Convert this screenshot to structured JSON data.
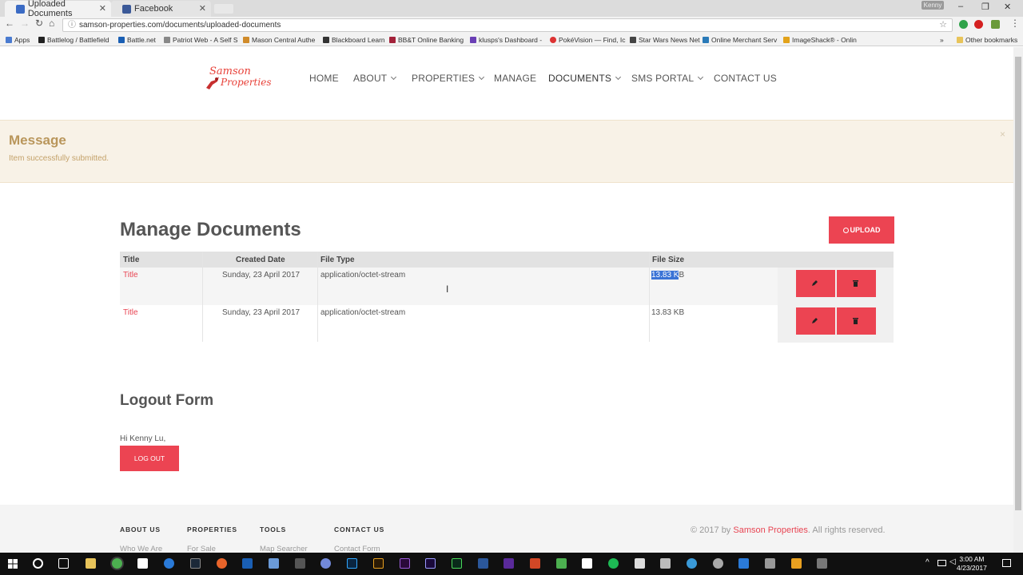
{
  "browser": {
    "tabs": [
      {
        "title": "Uploaded Documents",
        "active": true
      },
      {
        "title": "Facebook",
        "active": false
      }
    ],
    "profile": "Kenny",
    "window_controls": {
      "minimize": "–",
      "restore": "❐",
      "close": "✕"
    },
    "url": "samson-properties.com/documents/uploaded-documents",
    "bookmarks": [
      {
        "label": "Apps",
        "color": "#4a7bd0"
      },
      {
        "label": "Battlelog / Battlefield",
        "color": "#222"
      },
      {
        "label": "Battle.net",
        "color": "#1a5fb4"
      },
      {
        "label": "Patriot Web - A Self S",
        "color": "#888"
      },
      {
        "label": "Mason Central Authe",
        "color": "#d08b2a"
      },
      {
        "label": "Blackboard Learn",
        "color": "#333"
      },
      {
        "label": "BB&T Online Banking",
        "color": "#a3223a"
      },
      {
        "label": "klusps's Dashboard -",
        "color": "#6a3fb5"
      },
      {
        "label": "PokéVision — Find, Ic",
        "color": "#d33"
      },
      {
        "label": "Star Wars News Net",
        "color": "#444"
      },
      {
        "label": "Online Merchant Serv",
        "color": "#2a7ab8"
      },
      {
        "label": "ImageShack® - Onlin",
        "color": "#e2a21a"
      }
    ],
    "bookmarks_more": "»",
    "other_bookmarks": "Other bookmarks"
  },
  "site": {
    "logo_line1": "Samson",
    "logo_line2": "Properties",
    "nav": [
      {
        "label": "HOME",
        "dropdown": false
      },
      {
        "label": "ABOUT",
        "dropdown": true
      },
      {
        "label": "PROPERTIES",
        "dropdown": true
      },
      {
        "label": "MANAGE",
        "dropdown": false
      },
      {
        "label": "DOCUMENTS",
        "dropdown": true
      },
      {
        "label": "SMS PORTAL",
        "dropdown": true
      },
      {
        "label": "CONTACT US",
        "dropdown": false
      }
    ]
  },
  "message": {
    "title": "Message",
    "body": "Item successfully submitted.",
    "close": "×"
  },
  "documents": {
    "title": "Manage Documents",
    "upload_label": "UPLOAD",
    "columns": [
      "Title",
      "Created Date",
      "File Type",
      "File Size"
    ],
    "rows": [
      {
        "title": "Title",
        "created": "Sunday, 23 April 2017",
        "type": "application/octet-stream",
        "size_selected": "13.83 K",
        "size_rest": "B"
      },
      {
        "title": "Title",
        "created": "Sunday, 23 April 2017",
        "type": "application/octet-stream",
        "size": "13.83 KB"
      }
    ]
  },
  "logout": {
    "title": "Logout Form",
    "greeting": "Hi Kenny Lu,",
    "button": "LOG OUT"
  },
  "footer": {
    "headings": [
      "ABOUT US",
      "PROPERTIES",
      "TOOLS",
      "CONTACT US"
    ],
    "links": [
      "Who We Are",
      "For Sale",
      "Map Searcher",
      "Contact Form"
    ],
    "copyright_prefix": "© 2017 by ",
    "copyright_brand": "Samson Properties",
    "copyright_suffix": ". All rights reserved."
  },
  "taskbar": {
    "time": "3:00 AM",
    "date": "4/23/2017"
  },
  "colors": {
    "accent": "#ec4452",
    "message_bg": "#f8f2e7",
    "message_text": "#b9965b"
  }
}
